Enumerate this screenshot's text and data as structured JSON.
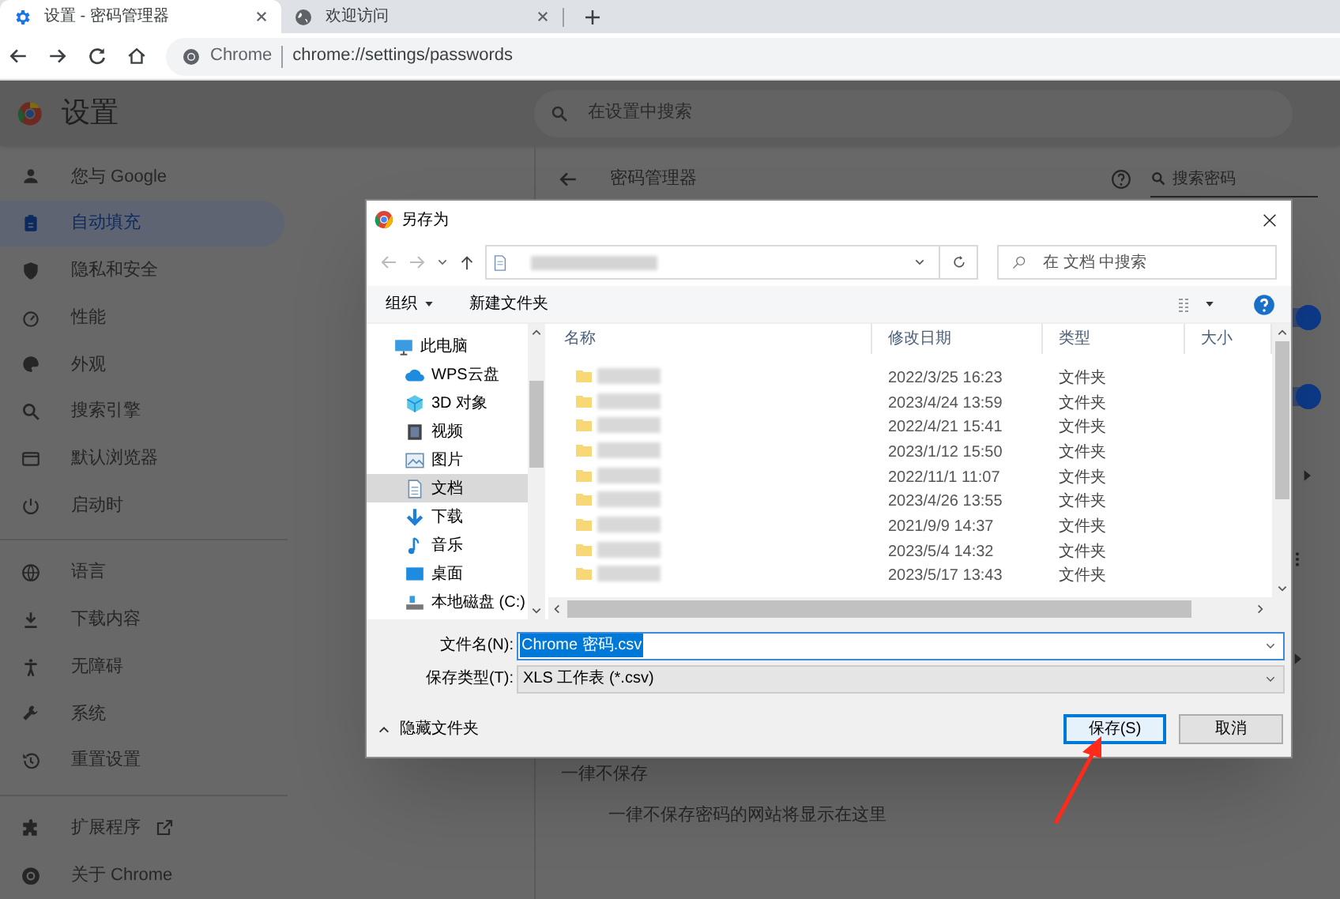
{
  "tabs": [
    {
      "kind": "settings",
      "title": "设置 - 密码管理器",
      "selected": true
    },
    {
      "kind": "web",
      "title": "欢迎访问",
      "selected": false
    }
  ],
  "address_bar": {
    "site_label": "Chrome",
    "url": "chrome://settings/passwords"
  },
  "settings_header": {
    "title": "设置",
    "search_placeholder": "在设置中搜索"
  },
  "sidebar": {
    "groups": [
      [
        {
          "label": "您与 Google",
          "selected": false
        },
        {
          "label": "自动填充",
          "selected": true
        },
        {
          "label": "隐私和安全",
          "selected": false
        },
        {
          "label": "性能",
          "selected": false
        },
        {
          "label": "外观",
          "selected": false
        },
        {
          "label": "搜索引擎",
          "selected": false
        },
        {
          "label": "默认浏览器",
          "selected": false
        },
        {
          "label": "启动时",
          "selected": false
        }
      ],
      [
        {
          "label": "语言",
          "selected": false
        },
        {
          "label": "下载内容",
          "selected": false
        },
        {
          "label": "无障碍",
          "selected": false
        },
        {
          "label": "系统",
          "selected": false
        },
        {
          "label": "重置设置",
          "selected": false
        }
      ],
      [
        {
          "label": "扩展程序",
          "selected": false
        },
        {
          "label": "关于 Chrome",
          "selected": false
        }
      ]
    ]
  },
  "password_manager": {
    "title": "密码管理器",
    "search_placeholder": "搜索密码",
    "toggles": [
      {
        "on": true
      },
      {
        "on": true
      }
    ],
    "never_save_title": "一律不保存",
    "never_save_note": "一律不保存密码的网站将显示在这里"
  },
  "dialog": {
    "title": "另存为",
    "search_placeholder": "在 文档 中搜索",
    "organize": "组织",
    "new_folder": "新建文件夹",
    "nav": [
      {
        "label": "此电脑",
        "selected": false,
        "children": [
          {
            "label": "WPS云盘",
            "selected": false
          },
          {
            "label": "3D 对象",
            "selected": false
          },
          {
            "label": "视频",
            "selected": false
          },
          {
            "label": "图片",
            "selected": false
          },
          {
            "label": "文档",
            "selected": true
          },
          {
            "label": "下载",
            "selected": false
          },
          {
            "label": "音乐",
            "selected": false
          },
          {
            "label": "桌面",
            "selected": false
          },
          {
            "label": "本地磁盘 (C:)",
            "selected": false
          }
        ]
      }
    ],
    "columns": [
      "名称",
      "修改日期",
      "类型",
      "大小"
    ],
    "rows": [
      {
        "date": "2022/3/25 16:23",
        "type": "文件夹"
      },
      {
        "date": "2023/4/24 13:59",
        "type": "文件夹"
      },
      {
        "date": "2022/4/21 15:41",
        "type": "文件夹"
      },
      {
        "date": "2023/1/12 15:50",
        "type": "文件夹"
      },
      {
        "date": "2022/11/1 11:07",
        "type": "文件夹"
      },
      {
        "date": "2023/4/26 13:55",
        "type": "文件夹"
      },
      {
        "date": "2021/9/9 14:37",
        "type": "文件夹"
      },
      {
        "date": "2023/5/4 14:32",
        "type": "文件夹"
      },
      {
        "date": "2023/5/17 13:43",
        "type": "文件夹"
      }
    ],
    "filename_label": "文件名(N):",
    "filename": "Chrome 密码.csv",
    "filetype_label": "保存类型(T):",
    "filetype": "XLS 工作表 (*.csv)",
    "hide_folders": "隐藏文件夹",
    "buttons": [
      {
        "label": "保存(S)",
        "default": true
      },
      {
        "label": "取消",
        "default": false
      }
    ]
  }
}
